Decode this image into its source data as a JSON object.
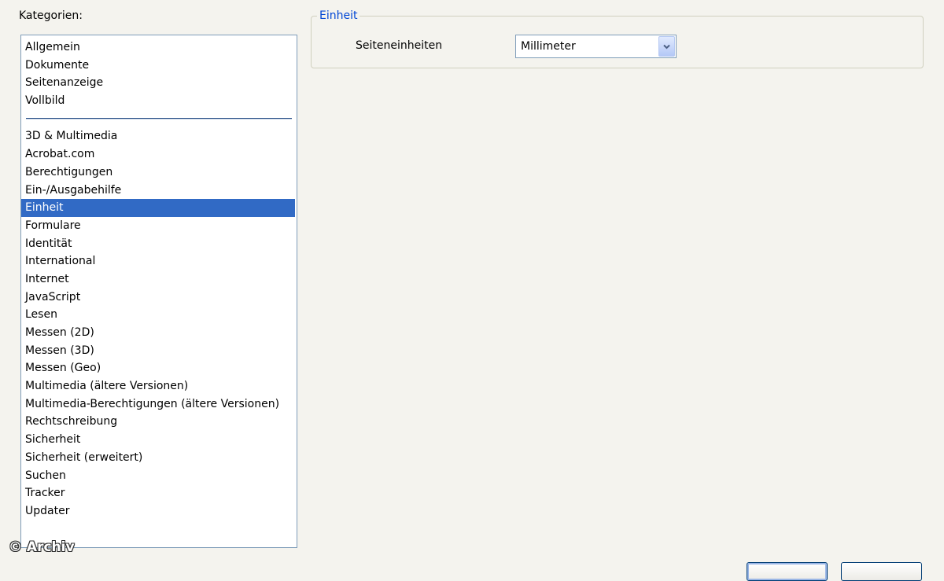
{
  "categories": {
    "label": "Kategorien:",
    "group1": [
      {
        "label": "Allgemein"
      },
      {
        "label": "Dokumente"
      },
      {
        "label": "Seitenanzeige"
      },
      {
        "label": "Vollbild"
      }
    ],
    "group2": [
      {
        "label": "3D & Multimedia"
      },
      {
        "label": "Acrobat.com"
      },
      {
        "label": "Berechtigungen"
      },
      {
        "label": "Ein-/Ausgabehilfe"
      },
      {
        "label": "Einheit"
      },
      {
        "label": "Formulare"
      },
      {
        "label": "Identität"
      },
      {
        "label": "International"
      },
      {
        "label": "Internet"
      },
      {
        "label": "JavaScript"
      },
      {
        "label": "Lesen"
      },
      {
        "label": "Messen (2D)"
      },
      {
        "label": "Messen (3D)"
      },
      {
        "label": "Messen (Geo)"
      },
      {
        "label": "Multimedia (ältere Versionen)"
      },
      {
        "label": "Multimedia-Berechtigungen (ältere Versionen)"
      },
      {
        "label": "Rechtschreibung"
      },
      {
        "label": "Sicherheit"
      },
      {
        "label": "Sicherheit (erweitert)"
      },
      {
        "label": "Suchen"
      },
      {
        "label": "Tracker"
      },
      {
        "label": "Updater"
      }
    ],
    "selected": "Einheit"
  },
  "panel": {
    "group_title": "Einheit",
    "page_units_label": "Seiteneinheiten",
    "page_units_value": "Millimeter"
  },
  "watermark": "© Archiv",
  "colors": {
    "selection": "#316ac5",
    "group_title": "#0046d5",
    "dialog_background": "#f4f3ee"
  }
}
